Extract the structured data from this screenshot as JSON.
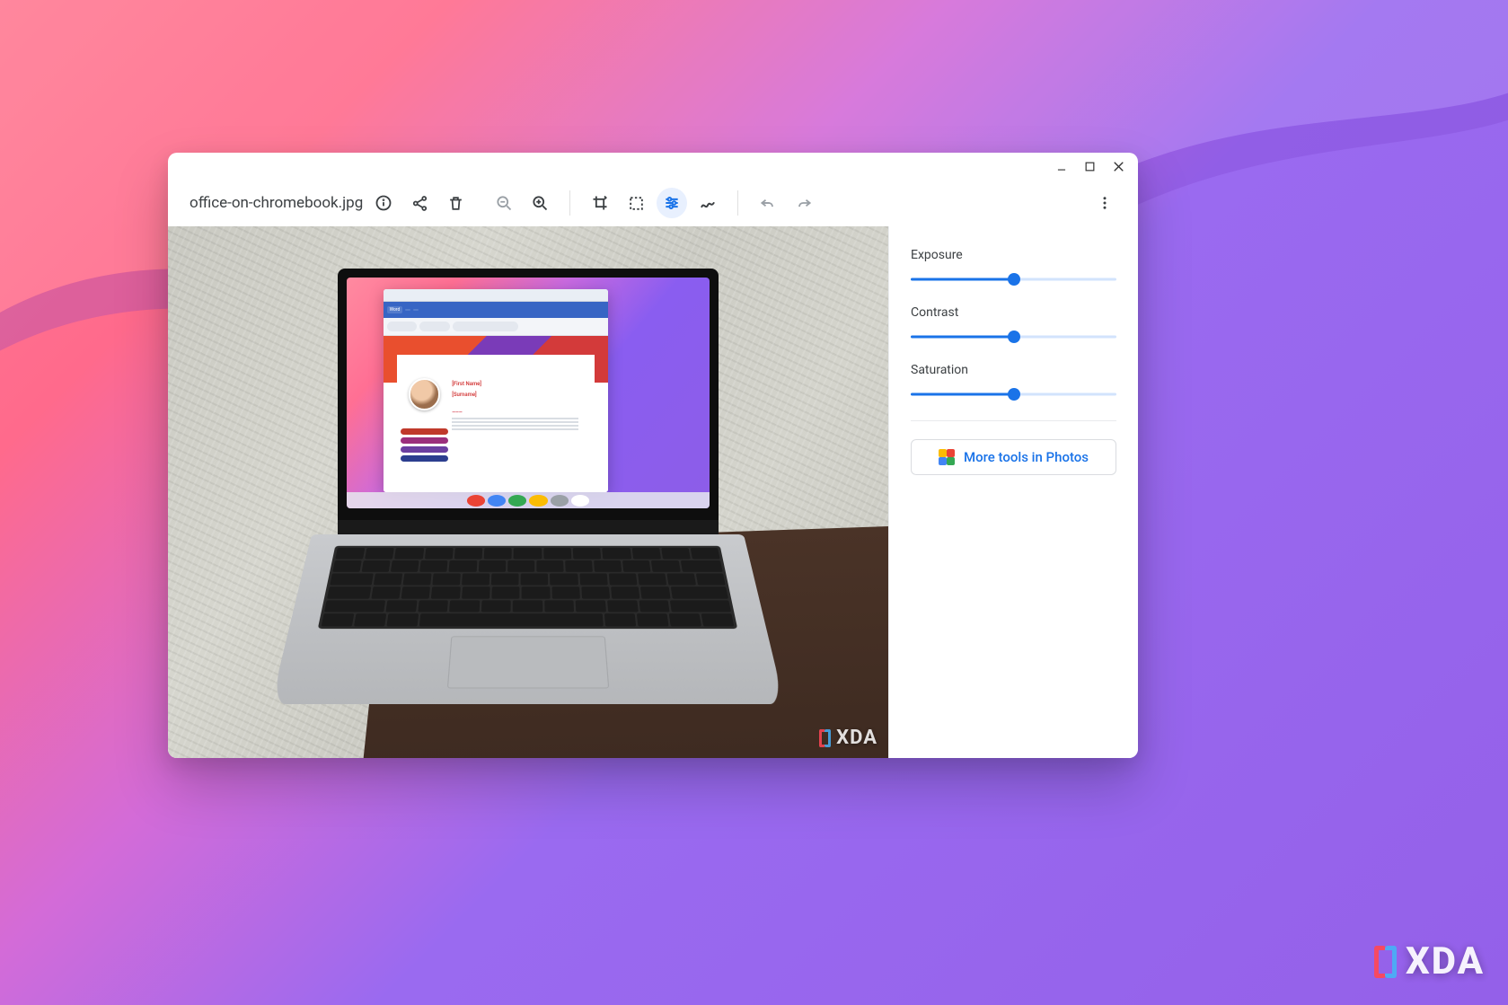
{
  "window_controls": {
    "minimize": "minimize",
    "maximize": "maximize",
    "close": "close"
  },
  "filename": "office-on-chromebook.jpg",
  "toolbar_icons": {
    "info": "info-icon",
    "share": "share-icon",
    "delete": "delete-icon",
    "zoom_out": "zoom-out-icon",
    "zoom_in": "zoom-in-icon",
    "crop": "crop-rotate-icon",
    "rescale": "rescale-icon",
    "adjust": "adjust-icon",
    "annotate": "annotate-icon",
    "undo": "undo-icon",
    "redo": "redo-icon",
    "overflow": "more-icon"
  },
  "sliders": [
    {
      "label": "Exposure",
      "value": 50,
      "min": 0,
      "max": 100
    },
    {
      "label": "Contrast",
      "value": 50,
      "min": 0,
      "max": 100
    },
    {
      "label": "Saturation",
      "value": 50,
      "min": 0,
      "max": 100
    }
  ],
  "more_tools_label": "More tools in Photos",
  "doc": {
    "first_name_placeholder": "[First Name]",
    "surname_placeholder": "[Surname]"
  },
  "watermark": "XDA",
  "colors": {
    "accent": "#1a73e8",
    "slider_track": "#d2e3fc",
    "text": "#3c4043"
  }
}
